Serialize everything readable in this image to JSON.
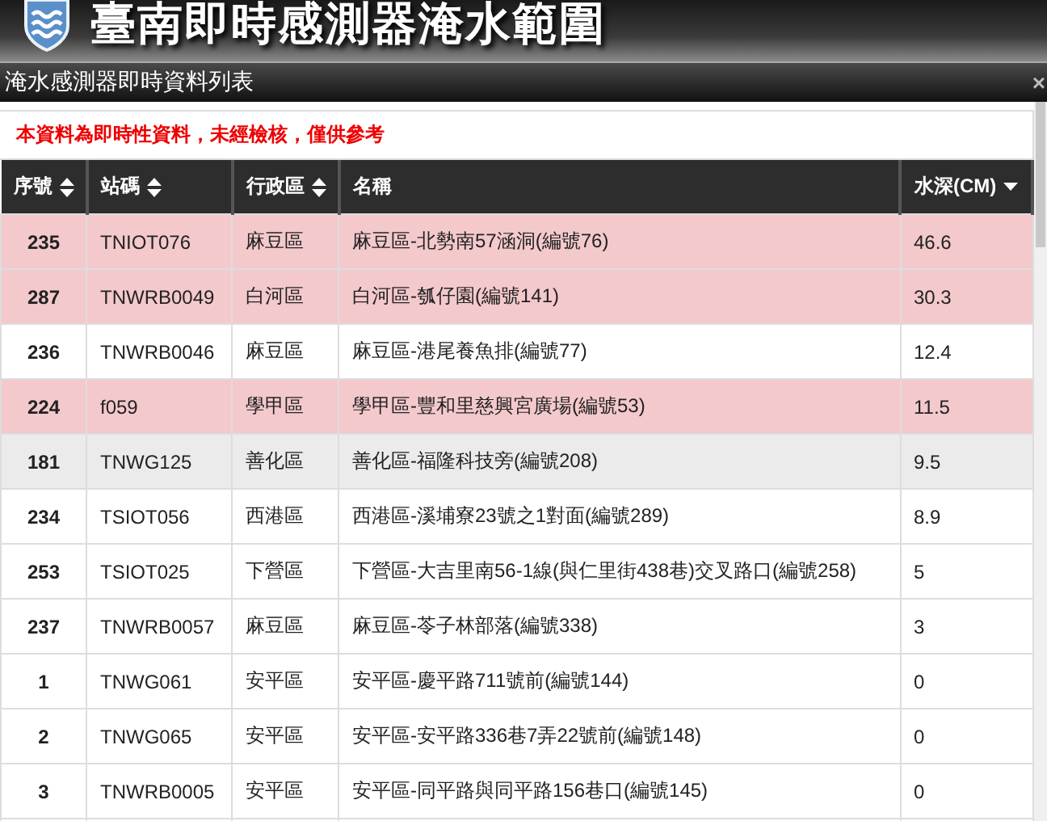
{
  "app": {
    "title": "臺南即時感測器淹水範圍"
  },
  "panel": {
    "title": "淹水感測器即時資料列表",
    "close": "×"
  },
  "notice": "本資料為即時性資料，未經檢核，僅供參考",
  "table": {
    "columns": [
      {
        "label": "序號",
        "sortable": true,
        "sorted_descending": false
      },
      {
        "label": "站碼",
        "sortable": true,
        "sorted_descending": false
      },
      {
        "label": "行政區",
        "sortable": true,
        "sorted_descending": false
      },
      {
        "label": "名稱",
        "sortable": false,
        "sorted_descending": false
      },
      {
        "label": "水深(CM)",
        "sortable": true,
        "sorted_descending": true
      }
    ],
    "rows": [
      {
        "cells": [
          "235",
          "TNIOT076",
          "麻豆區",
          "麻豆區-北勢南57涵洞(編號76)",
          "46.6"
        ],
        "warning": true,
        "hovered": false
      },
      {
        "cells": [
          "287",
          "TNWRB0049",
          "白河區",
          "白河區-瓠仔園(編號141)",
          "30.3"
        ],
        "warning": true,
        "hovered": false
      },
      {
        "cells": [
          "236",
          "TNWRB0046",
          "麻豆區",
          "麻豆區-港尾養魚排(編號77)",
          "12.4"
        ],
        "warning": false,
        "hovered": false
      },
      {
        "cells": [
          "224",
          "f059",
          "學甲區",
          "學甲區-豐和里慈興宮廣場(編號53)",
          "11.5"
        ],
        "warning": true,
        "hovered": false
      },
      {
        "cells": [
          "181",
          "TNWG125",
          "善化區",
          "善化區-福隆科技旁(編號208)",
          "9.5"
        ],
        "warning": false,
        "hovered": true
      },
      {
        "cells": [
          "234",
          "TSIOT056",
          "西港區",
          "西港區-溪埔寮23號之1對面(編號289)",
          "8.9"
        ],
        "warning": false,
        "hovered": false
      },
      {
        "cells": [
          "253",
          "TSIOT025",
          "下營區",
          "下營區-大吉里南56-1線(與仁里街438巷)交叉路口(編號258)",
          "5"
        ],
        "warning": false,
        "hovered": false
      },
      {
        "cells": [
          "237",
          "TNWRB0057",
          "麻豆區",
          "麻豆區-苓子林部落(編號338)",
          "3"
        ],
        "warning": false,
        "hovered": false
      },
      {
        "cells": [
          "1",
          "TNWG061",
          "安平區",
          "安平區-慶平路711號前(編號144)",
          "0"
        ],
        "warning": false,
        "hovered": false
      },
      {
        "cells": [
          "2",
          "TNWG065",
          "安平區",
          "安平區-安平路336巷7弄22號前(編號148)",
          "0"
        ],
        "warning": false,
        "hovered": false
      },
      {
        "cells": [
          "3",
          "TNWRB0005",
          "安平區",
          "安平區-同平路與同平路156巷口(編號145)",
          "0"
        ],
        "warning": false,
        "hovered": false
      }
    ]
  }
}
